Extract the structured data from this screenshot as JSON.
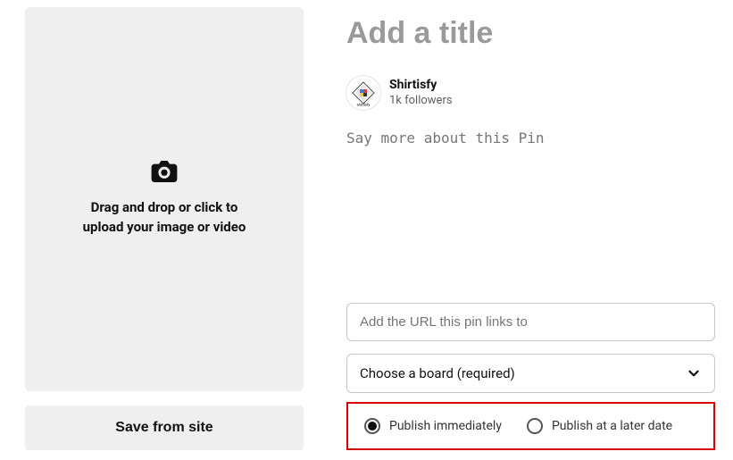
{
  "upload": {
    "line1": "Drag and drop or click to",
    "line2": "upload your image or video"
  },
  "save_from_site_label": "Save from site",
  "title_placeholder": "Add a title",
  "author": {
    "name": "Shirtisfy",
    "followers": "1k followers"
  },
  "description_placeholder": "Say more about this Pin",
  "url_placeholder": "Add the URL this pin links to",
  "board_select_label": "Choose a board (required)",
  "publish": {
    "immediate_label": "Publish immediately",
    "later_label": "Publish at a later date",
    "selected": "immediate"
  }
}
